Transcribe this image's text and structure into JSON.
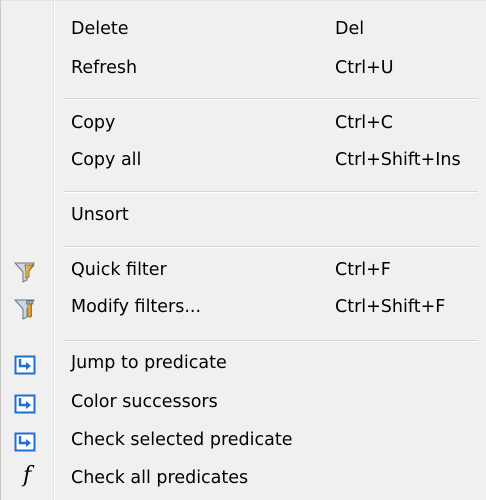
{
  "menu": {
    "items": [
      {
        "label": "Delete",
        "shortcut": "Del",
        "icon": null
      },
      {
        "label": "Refresh",
        "shortcut": "Ctrl+U",
        "icon": null
      },
      {
        "label": "Copy",
        "shortcut": "Ctrl+C",
        "icon": null
      },
      {
        "label": "Copy all",
        "shortcut": "Ctrl+Shift+Ins",
        "icon": null
      },
      {
        "label": "Unsort",
        "shortcut": "",
        "icon": null
      },
      {
        "label": "Quick filter",
        "shortcut": "Ctrl+F",
        "icon": "funnel-icon"
      },
      {
        "label": "Modify filters...",
        "shortcut": "Ctrl+Shift+F",
        "icon": "funnel-wrench-icon"
      },
      {
        "label": "Jump to predicate",
        "shortcut": "",
        "icon": "jump-arrow-icon"
      },
      {
        "label": "Color successors",
        "shortcut": "",
        "icon": "jump-arrow-icon"
      },
      {
        "label": "Check selected predicate",
        "shortcut": "",
        "icon": "jump-arrow-icon"
      },
      {
        "label": "Check all predicates",
        "shortcut": "",
        "icon": "function-icon"
      }
    ],
    "function_glyph": "f"
  },
  "colors": {
    "menu_background": "#f0f0f0",
    "separator": "#d7d7d7",
    "funnel_gold": "#e8a21c",
    "arrow_blue": "#1f6fd0"
  }
}
